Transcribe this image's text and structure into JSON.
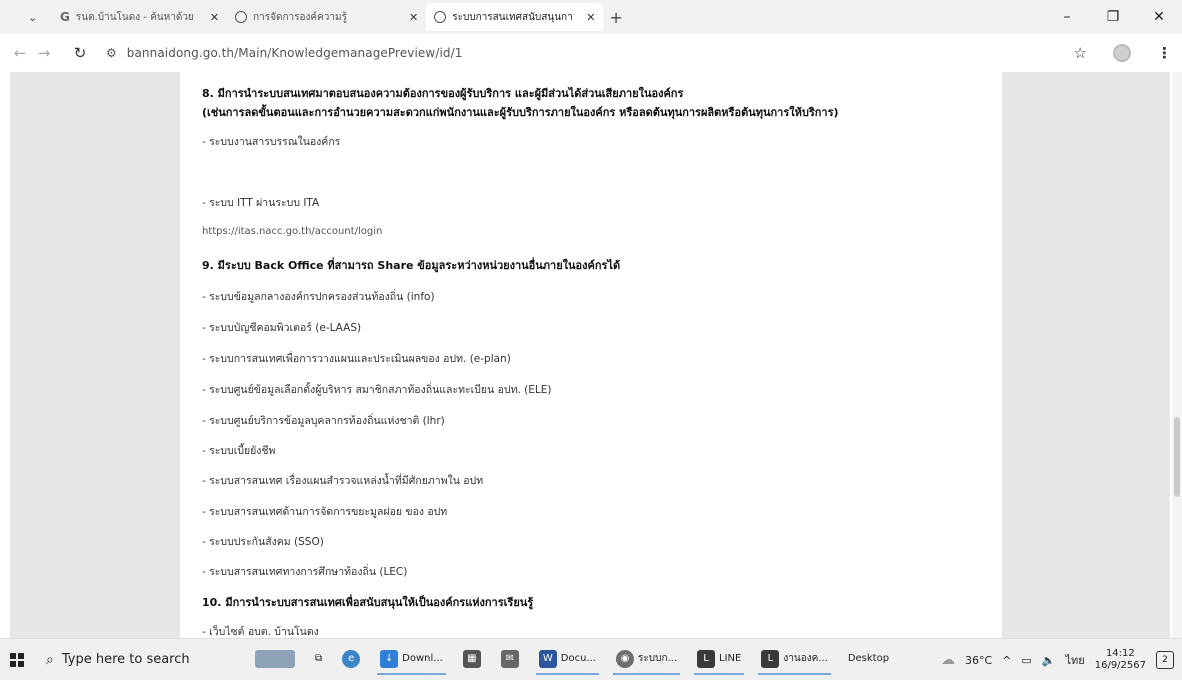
{
  "browser": {
    "tabs": [
      {
        "label": "รนต.บ้านโนดง - ค้นหาด้วย Google",
        "active": false
      },
      {
        "label": "การจัดการองค์ความรู้",
        "active": false
      },
      {
        "label": "ระบบการสนเทศสนับสนุนการบริหาร",
        "active": true
      }
    ],
    "url": "bannaidong.go.th/Main/KnowledgemanagePreview/id/1"
  },
  "content": {
    "lines": [
      {
        "text": "8. มีการนำระบบสนเทศมาตอบสนองความต้องการของผู้รับบริการ และผู้มีส่วนได้ส่วนเสียภายในองค์กร",
        "style": "heading"
      },
      {
        "text": "(เช่นการลดขั้นตอนและการอำนวยความสะดวกแก่พนักงานและผู้รับบริการภายในองค์กร หรือลดต้นทุนการผลิตหรือต้นทุนการให้บริการ)",
        "style": "heading"
      },
      {
        "text": "- ระบบงานสารบรรณในองค์กร",
        "style": "normal"
      },
      {
        "text": "- ระบบ ITT ผ่านระบบ ITA",
        "style": "normal"
      },
      {
        "text": "https://itas.nacc.go.th/account/login",
        "style": "link"
      },
      {
        "text": "9. มีระบบ Back Office ที่สามารถ Share ข้อมูลระหว่างหน่วยงานอื่นภายในองค์กรได้",
        "style": "heading"
      },
      {
        "text": "- ระบบข้อมูลกลางองค์กรปกครองส่วนท้องถิ่น (info)",
        "style": "normal"
      },
      {
        "text": "- ระบบบัญชีคอมพิวเตอร์ (e-LAAS)",
        "style": "normal"
      },
      {
        "text": "- ระบบการสนเทศเพื่อการวางแผนและประเมินผลของ อปท. (e-plan)",
        "style": "normal"
      },
      {
        "text": "- ระบบศูนย์ข้อมูลเลือกตั้งผู้บริหาร สมาชิกสภาท้องถิ่นและทะเบียน อปท. (ELE)",
        "style": "normal"
      },
      {
        "text": "- ระบบศูนย์บริการข้อมูลบุคลากรท้องถิ่นแห่งชาติ (lhr)",
        "style": "normal"
      },
      {
        "text": "- ระบบเบี้ยยังชีพ",
        "style": "normal"
      },
      {
        "text": "- ระบบสารสนเทศ เรื่องแผนสำรวจแหล่งน้ำที่มีศักยภาพใน อปท",
        "style": "normal"
      },
      {
        "text": "- ระบบสารสนเทศด้านการจัดการขยะมูลฝอย ของ อปท",
        "style": "normal"
      },
      {
        "text": "- ระบบประกันสังคม (SSO)",
        "style": "normal"
      },
      {
        "text": "- ระบบสารสนเทศทางการศึกษาท้องถิ่น (LEC)",
        "style": "normal"
      },
      {
        "text": "10. มีการนำระบบสารสนเทศเพื่อสนับสนุนให้เป็นองค์กรแห่งการเรียนรู้",
        "style": "heading"
      },
      {
        "text": "- เว็บไซต์ อบต. บ้านโนดง",
        "style": "normal"
      }
    ]
  },
  "taskbar": {
    "search_placeholder": "Type here to search",
    "items": [
      {
        "label": "Downl...",
        "icon": "download-icon",
        "color": "#2f7fd8"
      },
      {
        "label": "Docu...",
        "icon": "word-icon",
        "color": "#2b579a"
      },
      {
        "label": "ระบบก...",
        "icon": "chrome-icon",
        "color": "#6e6e6e"
      },
      {
        "label": "LINE",
        "icon": "line-icon",
        "color": "#3a3a3a"
      },
      {
        "label": "งานองค...",
        "icon": "line-icon",
        "color": "#3a3a3a"
      }
    ],
    "desktop_label": "Desktop",
    "temperature": "36°C",
    "language": "ไทย",
    "time": "14:12",
    "date": "16/9/2567",
    "notification_count": "2"
  }
}
